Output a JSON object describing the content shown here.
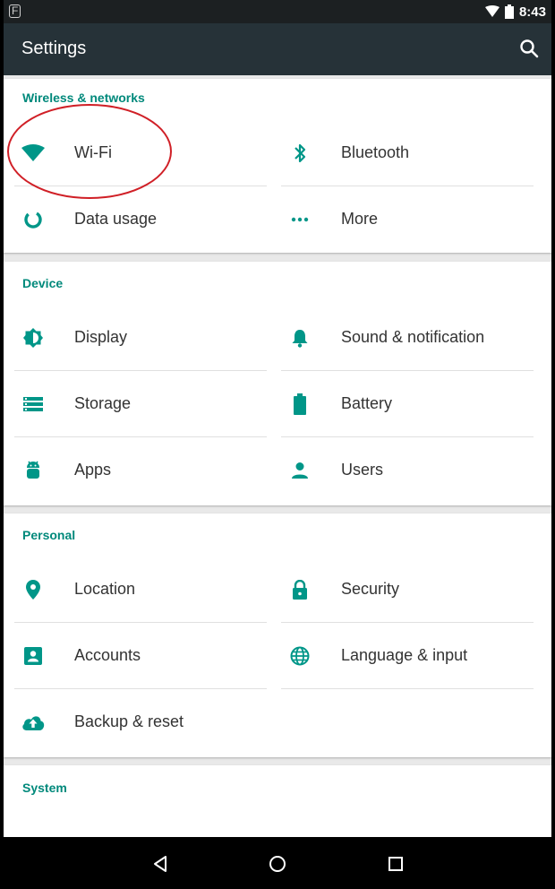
{
  "status_bar": {
    "time": "8:43",
    "notification_icon": "F"
  },
  "app_bar": {
    "title": "Settings",
    "search_icon": "search-icon"
  },
  "sections": {
    "wireless": {
      "title": "Wireless & networks",
      "items": [
        {
          "label": "Wi-Fi",
          "icon": "wifi-icon"
        },
        {
          "label": "Bluetooth",
          "icon": "bluetooth-icon"
        },
        {
          "label": "Data usage",
          "icon": "data-usage-icon"
        },
        {
          "label": "More",
          "icon": "more-icon"
        }
      ]
    },
    "device": {
      "title": "Device",
      "items": [
        {
          "label": "Display",
          "icon": "brightness-icon"
        },
        {
          "label": "Sound & notification",
          "icon": "bell-icon"
        },
        {
          "label": "Storage",
          "icon": "storage-icon"
        },
        {
          "label": "Battery",
          "icon": "battery-icon"
        },
        {
          "label": "Apps",
          "icon": "android-icon"
        },
        {
          "label": "Users",
          "icon": "user-icon"
        }
      ]
    },
    "personal": {
      "title": "Personal",
      "items": [
        {
          "label": "Location",
          "icon": "location-pin-icon"
        },
        {
          "label": "Security",
          "icon": "lock-icon"
        },
        {
          "label": "Accounts",
          "icon": "account-box-icon"
        },
        {
          "label": "Language & input",
          "icon": "globe-icon"
        },
        {
          "label": "Backup & reset",
          "icon": "cloud-upload-icon"
        }
      ]
    },
    "system": {
      "title": "System"
    }
  },
  "colors": {
    "accent": "#009688",
    "app_bar": "#263238",
    "status_bar": "#1c2022",
    "annotation": "#d01f26"
  },
  "nav_bar": {
    "back_icon": "back-icon",
    "home_icon": "home-icon",
    "recents_icon": "recents-icon"
  }
}
